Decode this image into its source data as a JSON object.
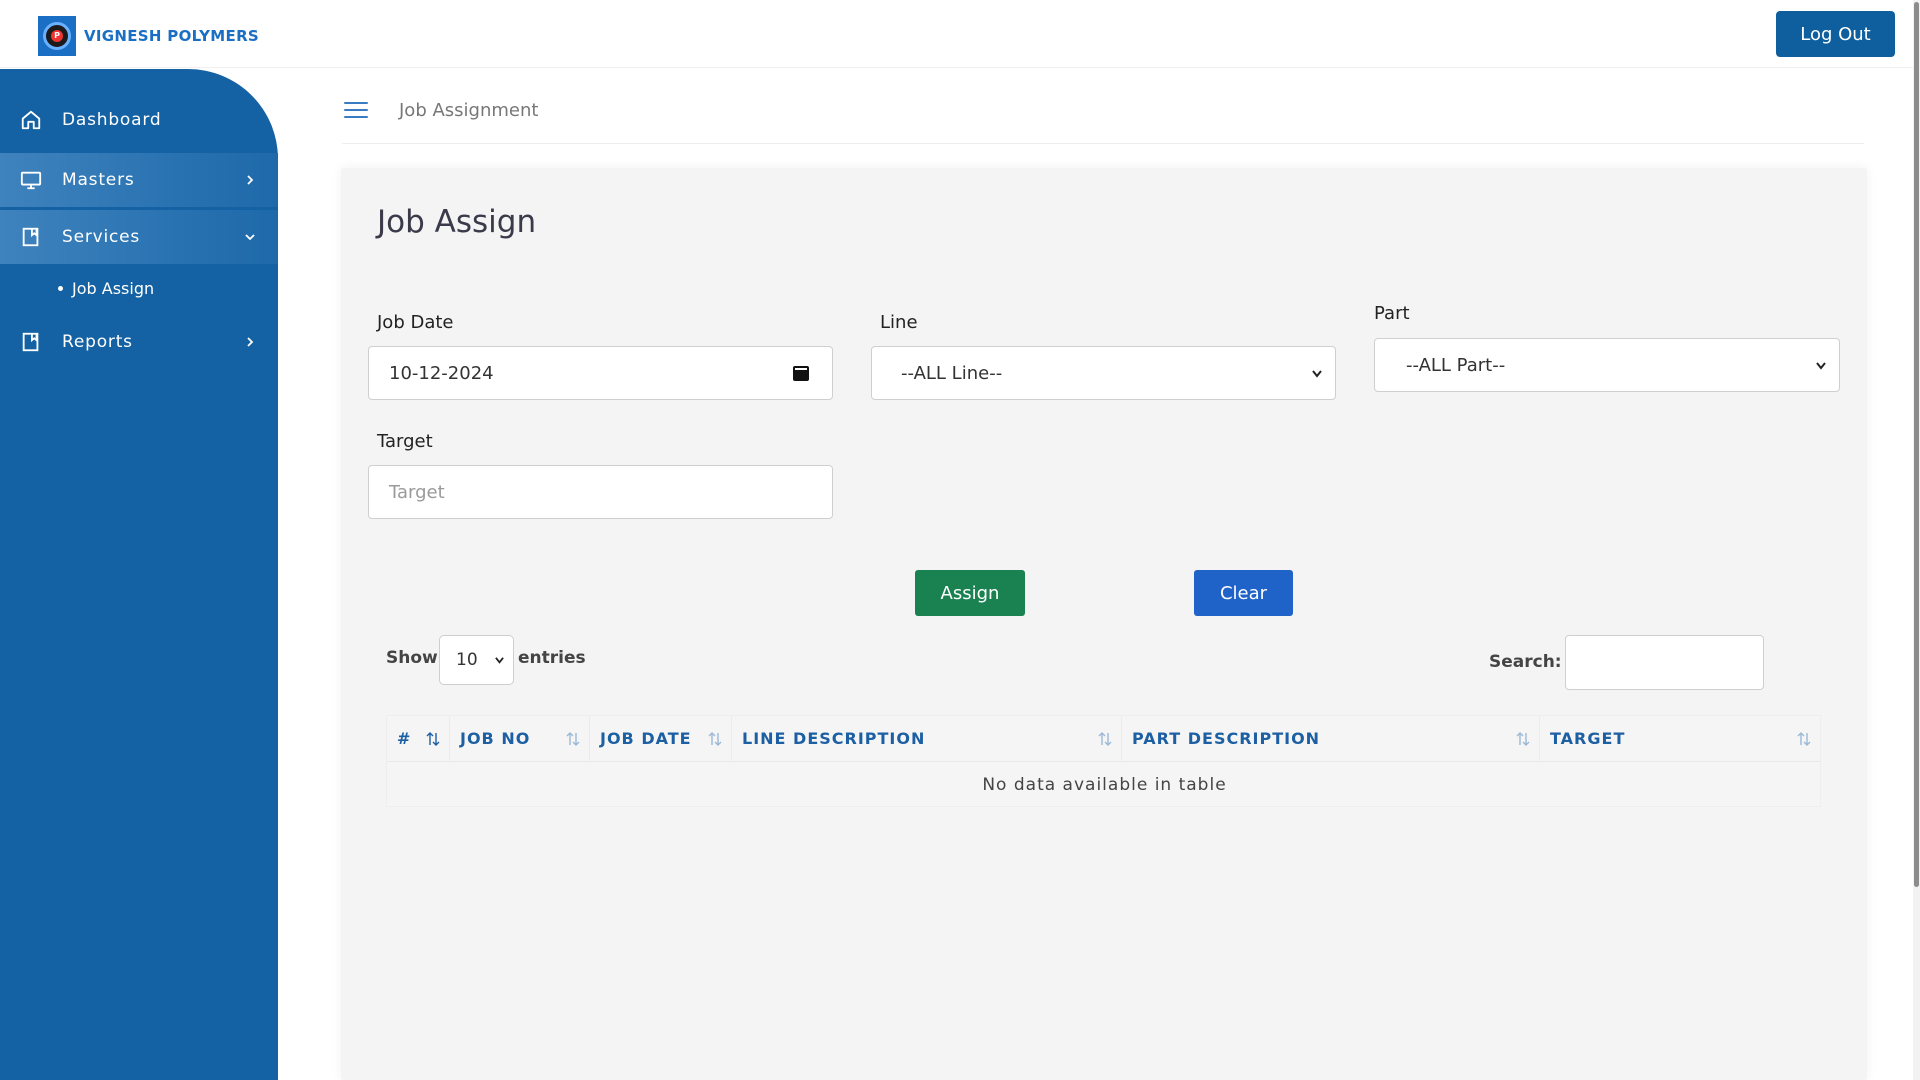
{
  "brand": {
    "name": "VIGNESH POLYMERS"
  },
  "header": {
    "logout_label": "Log Out"
  },
  "sidebar": {
    "items": [
      {
        "label": "Dashboard",
        "icon": "home-icon"
      },
      {
        "label": "Masters",
        "icon": "monitor-icon"
      },
      {
        "label": "Services",
        "icon": "bookmark-icon"
      },
      {
        "label": "Reports",
        "icon": "bookmark-icon"
      }
    ],
    "sub_items": [
      {
        "label": "Job Assign"
      }
    ]
  },
  "breadcrumb": {
    "label": "Job Assignment"
  },
  "form": {
    "title": "Job Assign",
    "job_date": {
      "label": "Job Date",
      "value": "10-12-2024"
    },
    "line": {
      "label": "Line",
      "value": "--ALL Line--"
    },
    "part": {
      "label": "Part",
      "value": "--ALL Part--"
    },
    "target": {
      "label": "Target",
      "placeholder": "Target"
    },
    "assign_label": "Assign",
    "clear_label": "Clear"
  },
  "table": {
    "show_label": "Show",
    "entries_value": "10",
    "entries_label": "entries",
    "search_label": "Search:",
    "columns": [
      "#",
      "JOB NO",
      "JOB DATE",
      "LINE DESCRIPTION",
      "PART DESCRIPTION",
      "TARGET"
    ],
    "empty_message": "No data available in table"
  },
  "colors": {
    "sidebar": "#1462a3",
    "logout": "#0f5f9f",
    "assign": "#1a8250",
    "clear": "#1f62c8",
    "table_header_text": "#1d5fa3"
  }
}
